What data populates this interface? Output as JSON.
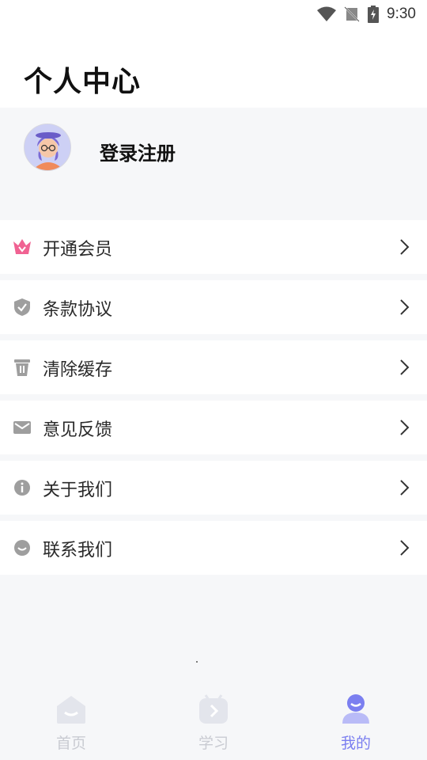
{
  "status_bar": {
    "time": "9:30"
  },
  "header": {
    "title": "个人中心"
  },
  "profile": {
    "login_label": "登录注册"
  },
  "menu": [
    {
      "label": "开通会员",
      "icon": "crown-icon"
    },
    {
      "label": "条款协议",
      "icon": "shield-icon"
    },
    {
      "label": "清除缓存",
      "icon": "trash-icon"
    },
    {
      "label": "意见反馈",
      "icon": "mail-icon"
    },
    {
      "label": "关于我们",
      "icon": "info-icon"
    },
    {
      "label": "联系我们",
      "icon": "chat-icon"
    }
  ],
  "tabs": [
    {
      "label": "首页",
      "active": false
    },
    {
      "label": "学习",
      "active": false
    },
    {
      "label": "我的",
      "active": true
    }
  ],
  "colors": {
    "accent": "#7b7ff0",
    "crown": "#f06292",
    "icon_gray": "#9e9e9e"
  }
}
